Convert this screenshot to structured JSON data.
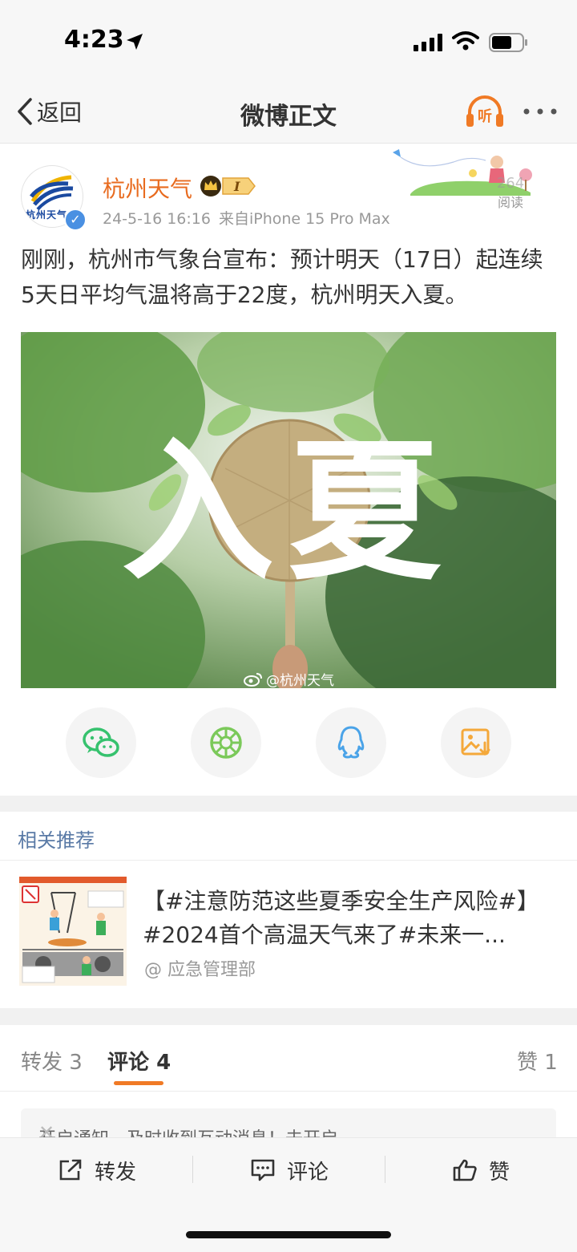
{
  "status": {
    "time": "4:23"
  },
  "nav": {
    "back_label": "返回",
    "title": "微博正文",
    "listen_label": "听"
  },
  "post": {
    "author": "杭州天气",
    "avatar_text": "杭州天气",
    "badge_level": "I",
    "timestamp": "24-5-16 16:16",
    "source": "来自iPhone 15 Pro Max",
    "read_count": "264",
    "read_label": "阅读",
    "text": "刚刚，杭州市气象台宣布：预计明天（17日）起连续5天日平均气温将高于22度，杭州明天入夏。",
    "image_caption": "入夏",
    "watermark": "@杭州天气"
  },
  "share": {
    "items": [
      {
        "icon": "wechat-icon",
        "color": "#36c26e"
      },
      {
        "icon": "moments-icon",
        "color": "#7bc95a"
      },
      {
        "icon": "qq-icon",
        "color": "#4aa3e8"
      },
      {
        "icon": "save-image-icon",
        "color": "#f4a83a"
      }
    ]
  },
  "related": {
    "header": "相关推荐",
    "item": {
      "title": "【#注意防范这些夏季安全生产风险#】#2024首个高温天气来了#未来一...",
      "source": "@ 应急管理部"
    }
  },
  "tabs": {
    "repost_label": "转发",
    "repost_count": "3",
    "comment_label": "评论",
    "comment_count": "4",
    "like_label": "赞",
    "like_count": "1"
  },
  "notice": {
    "text": "开启通知，及时收到互动消息！去开启"
  },
  "bottom": {
    "repost": "转发",
    "comment": "评论",
    "like": "赞"
  },
  "colors": {
    "accent": "#f07a25",
    "username": "#e86b1f",
    "link_blue": "#5a7aa6"
  }
}
